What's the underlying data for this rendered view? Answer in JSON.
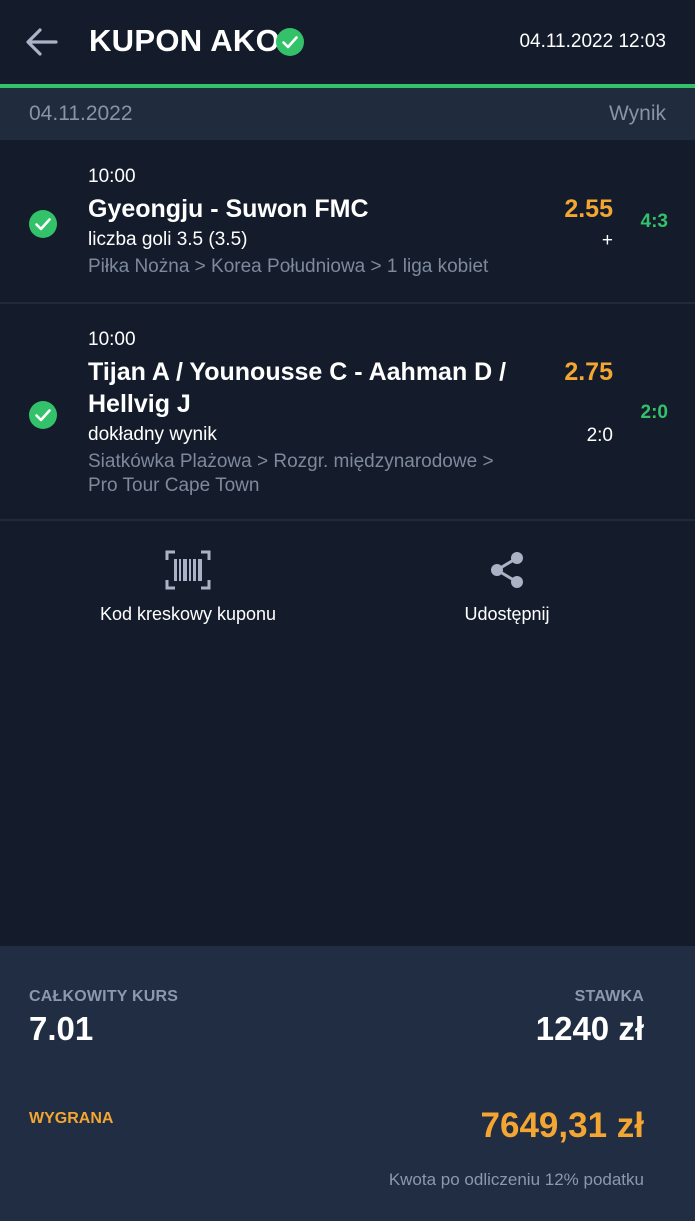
{
  "header": {
    "title": "KUPON AKO",
    "datetime": "04.11.2022 12:03",
    "accent_color": "#33c26a"
  },
  "date_bar": {
    "date": "04.11.2022",
    "result_label": "Wynik"
  },
  "events": [
    {
      "time": "10:00",
      "name": "Gyeongju - Suwon FMC",
      "market": "liczba goli 3.5 (3.5)",
      "path": "Piłka Nożna > Korea Południowa > 1 liga kobiet",
      "odds": "2.55",
      "pick": "+",
      "score": "4:3",
      "status": "won"
    },
    {
      "time": "10:00",
      "name": "Tijan A / Younousse C - Aahman D / Hellvig J",
      "market": "dokładny wynik",
      "path": "Siatkówka Plażowa > Rozgr. międzynarodowe > Pro Tour Cape Town",
      "odds": "2.75",
      "pick": "2:0",
      "score": "2:0",
      "status": "won"
    }
  ],
  "actions": {
    "barcode_label": "Kod kreskowy kuponu",
    "share_label": "Udostępnij"
  },
  "summary": {
    "total_odds_label": "CAŁKOWITY KURS",
    "total_odds": "7.01",
    "stake_label": "STAWKA",
    "stake": "1240 zł",
    "win_label": "WYGRANA",
    "win_amount": "7649,31 zł",
    "tax_note": "Kwota po odliczeniu 12% podatku"
  },
  "colors": {
    "background": "#141c2b",
    "odds": "#f3a632",
    "win": "#33c26a",
    "muted": "#7e899c"
  }
}
